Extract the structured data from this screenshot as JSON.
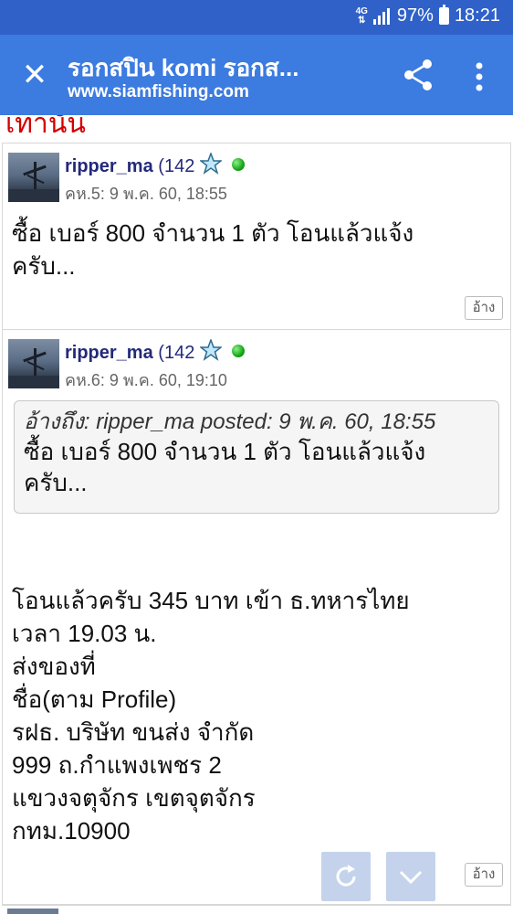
{
  "status_bar": {
    "network": "4G",
    "battery": "97%",
    "battery_level": 0.97,
    "time": "18:21"
  },
  "app_bar": {
    "close_icon": "close-icon",
    "title": "รอกสปิน komi รอกส...",
    "url": "www.siamfishing.com",
    "share_icon": "share-icon",
    "more_icon": "more-vert-icon"
  },
  "partial_top_text": "เท่านั้น",
  "posts": [
    {
      "username": "ripper_ma",
      "points_open": "(142",
      "meta": "คห.5: 9 พ.ค. 60, 18:55",
      "body_lines": [
        "ซื้อ เบอร์ 800 จำนวน 1 ตัว โอนแล้วแจ้ง",
        "ครับ..."
      ],
      "quote_button": "อ้าง"
    },
    {
      "username": "ripper_ma",
      "points_open": "(142",
      "meta": "คห.6: 9 พ.ค. 60, 19:10",
      "quote": {
        "header": "อ้างถึง: ripper_ma posted: 9 พ.ค. 60, 18:55",
        "lines": [
          "ซื้อ เบอร์ 800 จำนวน 1 ตัว โอนแล้วแจ้ง",
          "ครับ..."
        ]
      },
      "body_lines": [
        "โอนแล้วครับ 345 บาท เข้า ธ.ทหารไทย",
        "เวลา 19.03 น.",
        "ส่งของที่",
        "ชื่อ(ตาม Profile)",
        "รฝธ. บริษัท ขนส่ง จำกัด",
        "999 ถ.กำแพงเพชร 2",
        "แขวงจตุจักร เขตจุตจักร",
        "กทม.10900"
      ],
      "quote_button": "อ้าง"
    }
  ],
  "floating_buttons": {
    "refresh_icon": "refresh-icon",
    "scroll_down_icon": "chevron-down-icon"
  },
  "colors": {
    "status_bar": "#2f61c9",
    "app_bar": "#3c7be0",
    "username": "#23297a",
    "online": "#17a517",
    "partial_heading": "#d40000"
  }
}
